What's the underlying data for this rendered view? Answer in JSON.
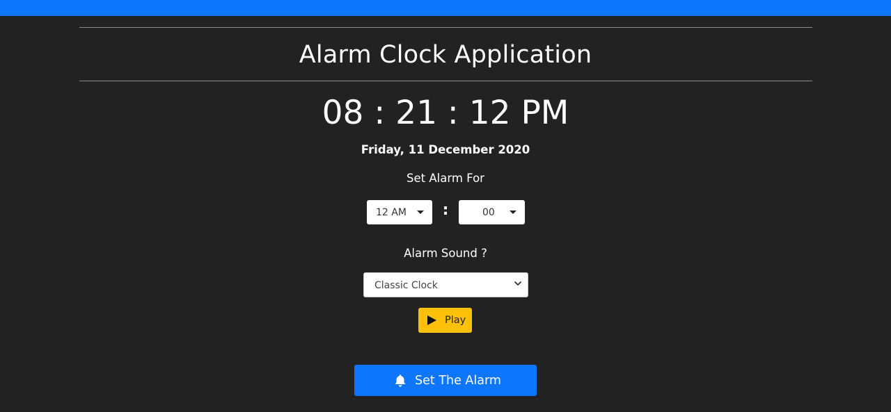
{
  "header": {
    "title": "Alarm Clock Application"
  },
  "clock": {
    "time": "08 : 21 : 12 PM",
    "date": "Friday, 11 December 2020"
  },
  "alarm": {
    "label": "Set Alarm For",
    "hour_value": "12 AM",
    "separator": ":",
    "minute_value": "00"
  },
  "sound": {
    "label": "Alarm Sound ?",
    "selected": "Classic Clock",
    "play_label": "Play"
  },
  "actions": {
    "set_alarm_label": "Set The Alarm"
  },
  "colors": {
    "accent": "#0d76fb",
    "background": "#222222",
    "warning": "#ffc107"
  }
}
